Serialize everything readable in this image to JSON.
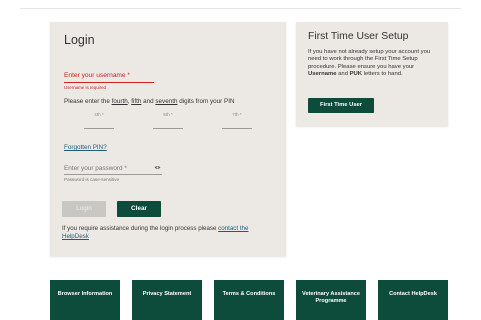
{
  "login": {
    "title": "Login",
    "username": {
      "label": "Enter your username *",
      "error": "Username is required"
    },
    "pin_instruction": {
      "prefix": "Please enter the ",
      "d1": "fourth",
      "sep1": ", ",
      "d2": "fifth",
      "sep2": " and ",
      "d3": "seventh",
      "suffix": " digits from your PIN"
    },
    "pin_fields": [
      {
        "label": "4th *"
      },
      {
        "label": "5th *"
      },
      {
        "label": "7th *"
      }
    ],
    "forgotten_pin": "Forgotten PIN?",
    "password": {
      "label": "Enter your password *",
      "help": "Password is case-sensitive"
    },
    "login_button": "Login",
    "clear_button": "Clear",
    "help_text": "If you require assistance during the login process please ",
    "help_link": "contact the HelpDesk"
  },
  "setup": {
    "title": "First Time User Setup",
    "text1": "If you have not already setup your account you need to work through the First Time Setup procedure. Please ensure you have your ",
    "username_word": "Username",
    "text2": " and ",
    "puk_word": "PUK",
    "text3": " letters to hand.",
    "button": "First Time User"
  },
  "footer": [
    {
      "label": "Browser Information"
    },
    {
      "label": "Privacy Statement"
    },
    {
      "label": "Terms & Conditions"
    },
    {
      "label": "Veterinary Assistance Programme"
    },
    {
      "label": "Contact HelpDesk"
    }
  ],
  "colors": {
    "accent": "#0d4b3b",
    "error": "#d32020",
    "panel": "#ece9e4",
    "link": "#1f5a7a"
  },
  "icons": {
    "password_toggle": "eye-icon"
  }
}
